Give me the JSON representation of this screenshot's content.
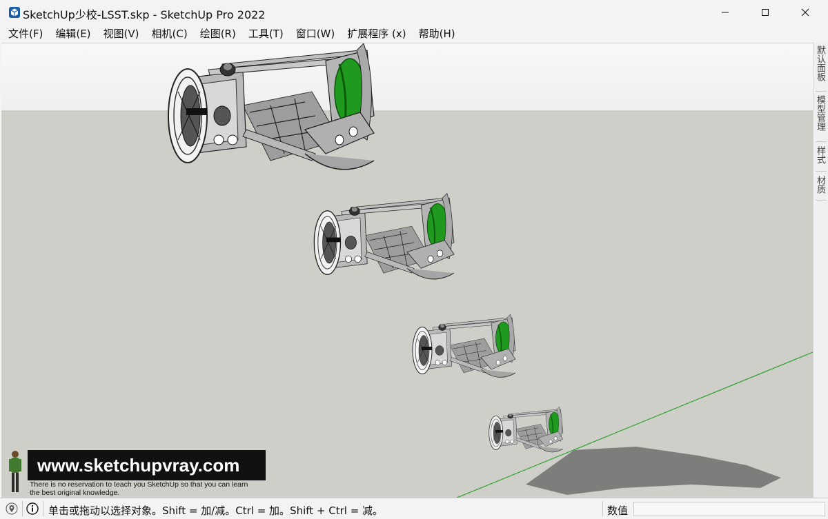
{
  "window": {
    "title": "SketchUp少校-LSST.skp - SketchUp Pro 2022",
    "controls": {
      "minimize": "—",
      "maximize": "☐",
      "close": "✕"
    }
  },
  "menubar": {
    "items": [
      {
        "label": "文件(F)"
      },
      {
        "label": "编辑(E)"
      },
      {
        "label": "视图(V)"
      },
      {
        "label": "相机(C)"
      },
      {
        "label": "绘图(R)"
      },
      {
        "label": "工具(T)"
      },
      {
        "label": "窗口(W)"
      },
      {
        "label": "扩展程序 (x)"
      },
      {
        "label": "帮助(H)"
      }
    ]
  },
  "tray": {
    "tabs": [
      {
        "label": "默认面板"
      },
      {
        "label": "模型管理"
      },
      {
        "label": "样式"
      },
      {
        "label": "材质"
      }
    ]
  },
  "watermark": {
    "url": "www.sketchupvray.com",
    "line1": "There is no reservation to teach you SketchUp so that you can learn",
    "line2": " the best original knowledge."
  },
  "statusbar": {
    "hint": "单击或拖动以选择对象。Shift = 加/减。Ctrl = 加。Shift + Ctrl = 减。",
    "measure_label": "数值",
    "measure_value": ""
  },
  "colors": {
    "sky": "#f4f4f4",
    "ground": "#cfcfca",
    "green_axis": "#2ea02e",
    "mirror_green": "#1f9a1f",
    "metal": "#a8a8a8"
  },
  "icons": {
    "app": "sketchup-logo-icon",
    "geo": "location-icon",
    "info": "info-icon"
  }
}
